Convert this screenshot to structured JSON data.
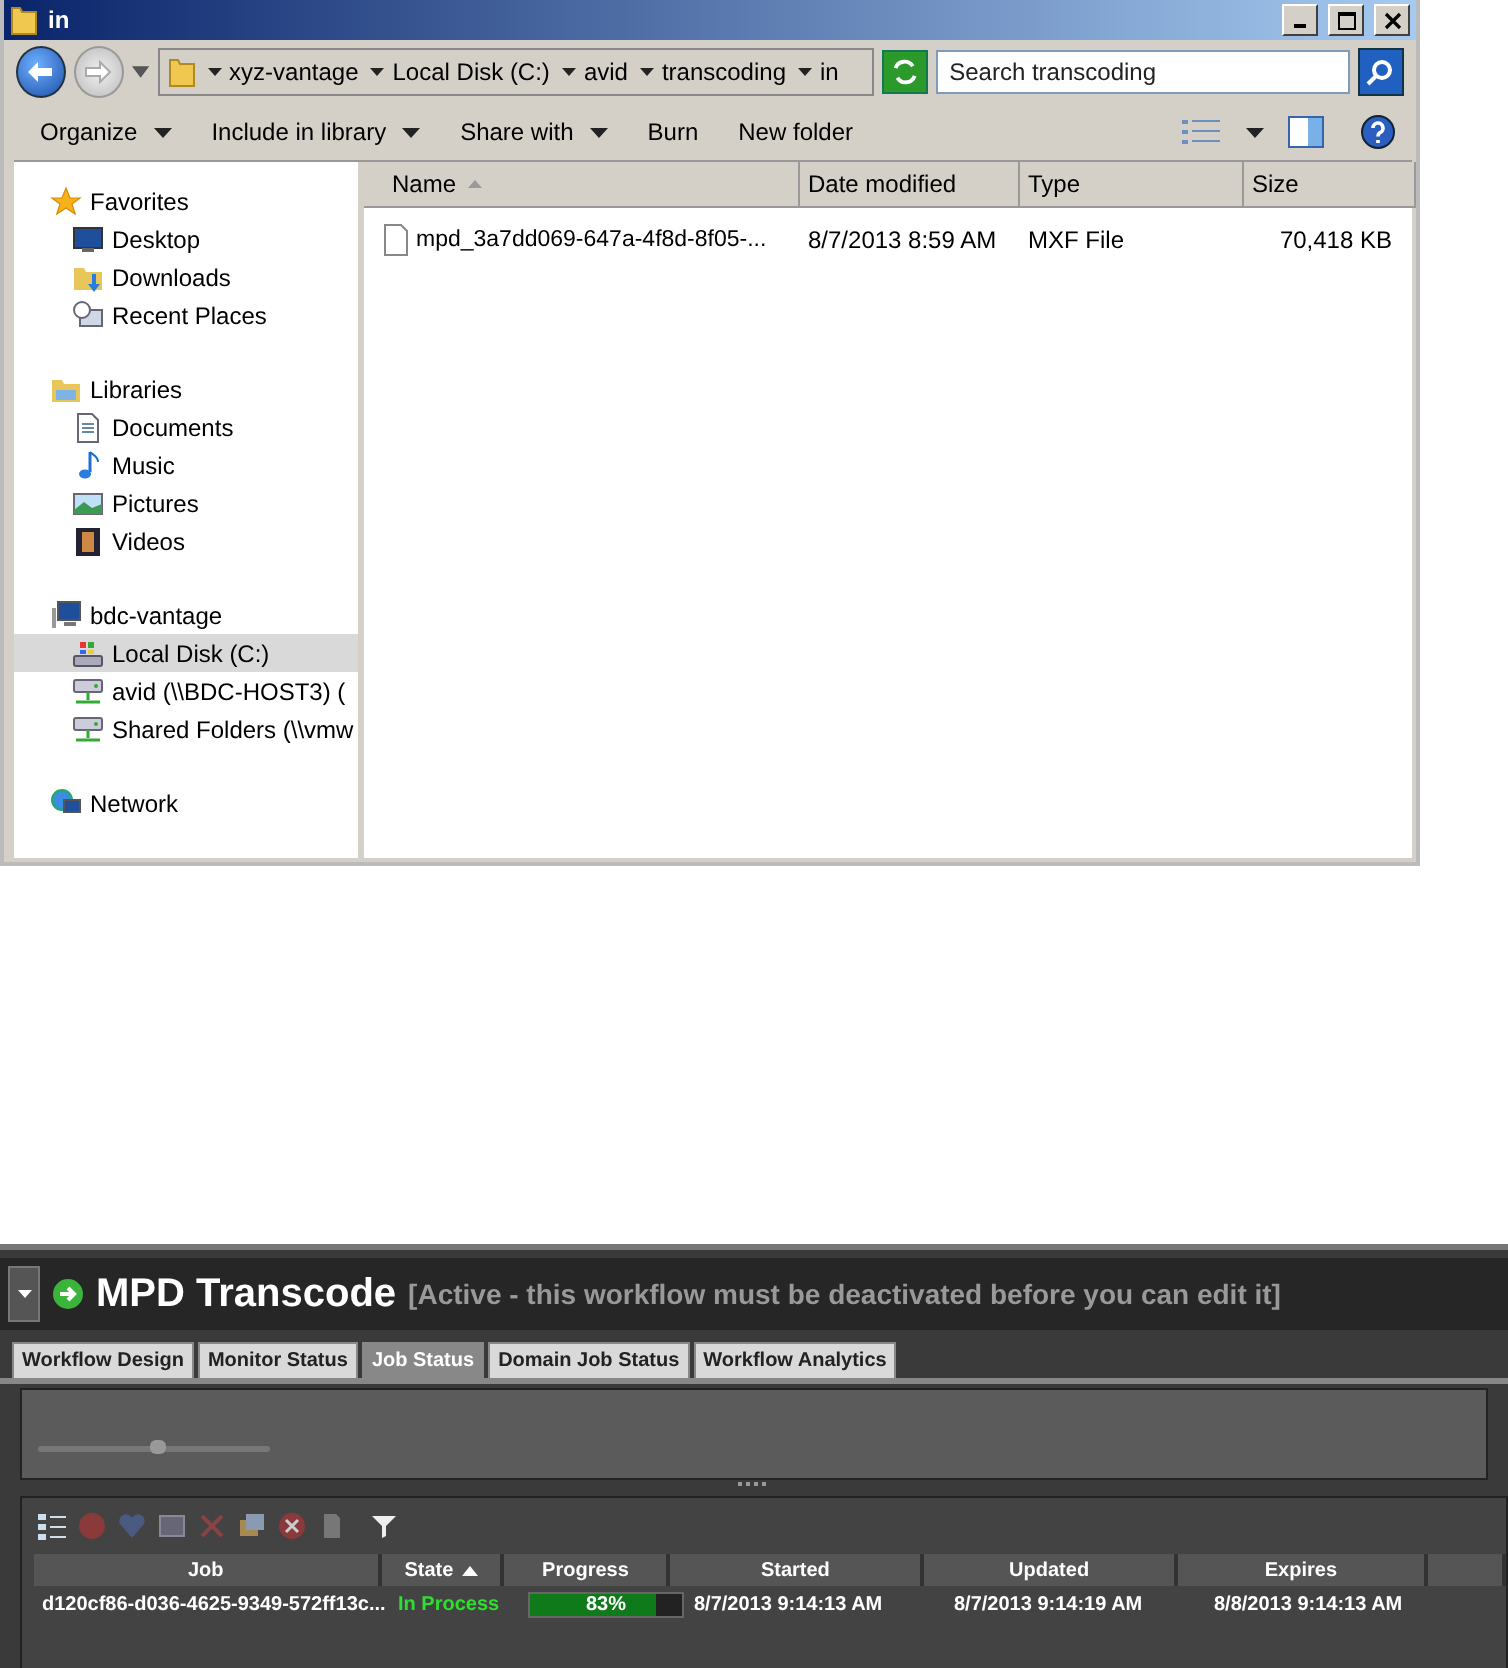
{
  "explorer": {
    "title": "in",
    "breadcrumbs": [
      "xyz-vantage",
      "Local Disk (C:)",
      "avid",
      "transcoding",
      "in"
    ],
    "search": {
      "placeholder": "Search transcoding"
    },
    "toolbar": [
      {
        "label": "Organize",
        "dropdown": true
      },
      {
        "label": "Include in library",
        "dropdown": true
      },
      {
        "label": "Share with",
        "dropdown": true
      },
      {
        "label": "Burn",
        "dropdown": false
      },
      {
        "label": "New folder",
        "dropdown": false
      }
    ],
    "nav": [
      {
        "label": "Favorites",
        "children": [
          {
            "label": "Desktop",
            "selected": false
          },
          {
            "label": "Downloads",
            "selected": false
          },
          {
            "label": "Recent Places",
            "selected": false
          }
        ]
      },
      {
        "label": "Libraries",
        "children": [
          {
            "label": "Documents",
            "selected": false
          },
          {
            "label": "Music",
            "selected": false
          },
          {
            "label": "Pictures",
            "selected": false
          },
          {
            "label": "Videos",
            "selected": false
          }
        ]
      },
      {
        "label": "bdc-vantage",
        "children": [
          {
            "label": "Local Disk (C:)",
            "selected": true
          },
          {
            "label": "avid (\\\\BDC-HOST3) (",
            "selected": false
          },
          {
            "label": "Shared Folders (\\\\vmw",
            "selected": false
          }
        ]
      },
      {
        "label": "Network"
      }
    ],
    "columns": [
      {
        "label": "Name",
        "sorted": true
      },
      {
        "label": "Date modified",
        "sorted": false
      },
      {
        "label": "Type",
        "sorted": false
      },
      {
        "label": "Size",
        "sorted": false
      }
    ],
    "files": [
      {
        "name": "mpd_3a7dd069-647a-4f8d-8f05-...",
        "date": "8/7/2013 8:59 AM",
        "type": "MXF File",
        "size": "70,418 KB"
      }
    ]
  },
  "workflow": {
    "title": "MPD Transcode",
    "status": "[Active - this workflow must be deactivated before you can edit it]",
    "tabs": [
      {
        "label": "Workflow Design",
        "selected": false
      },
      {
        "label": "Monitor Status",
        "selected": false
      },
      {
        "label": "Job Status",
        "selected": true
      },
      {
        "label": "Domain Job Status",
        "selected": false
      },
      {
        "label": "Workflow Analytics",
        "selected": false
      }
    ],
    "slider": {
      "level": 0.52
    },
    "columns": [
      {
        "label": "Job",
        "sorted": false
      },
      {
        "label": "State",
        "sorted": true
      },
      {
        "label": "Progress",
        "sorted": false
      },
      {
        "label": "Started",
        "sorted": false
      },
      {
        "label": "Updated",
        "sorted": false
      },
      {
        "label": "Expires",
        "sorted": false
      }
    ],
    "rows": [
      {
        "job": "d120cf86-d036-4625-9349-572ff13c...",
        "state": "In Process",
        "level": 0.83,
        "progress": "83%",
        "started": "8/7/2013 9:14:13 AM",
        "updated": "8/7/2013 9:14:19 AM",
        "expires": "8/8/2013 9:14:13 AM"
      }
    ]
  }
}
